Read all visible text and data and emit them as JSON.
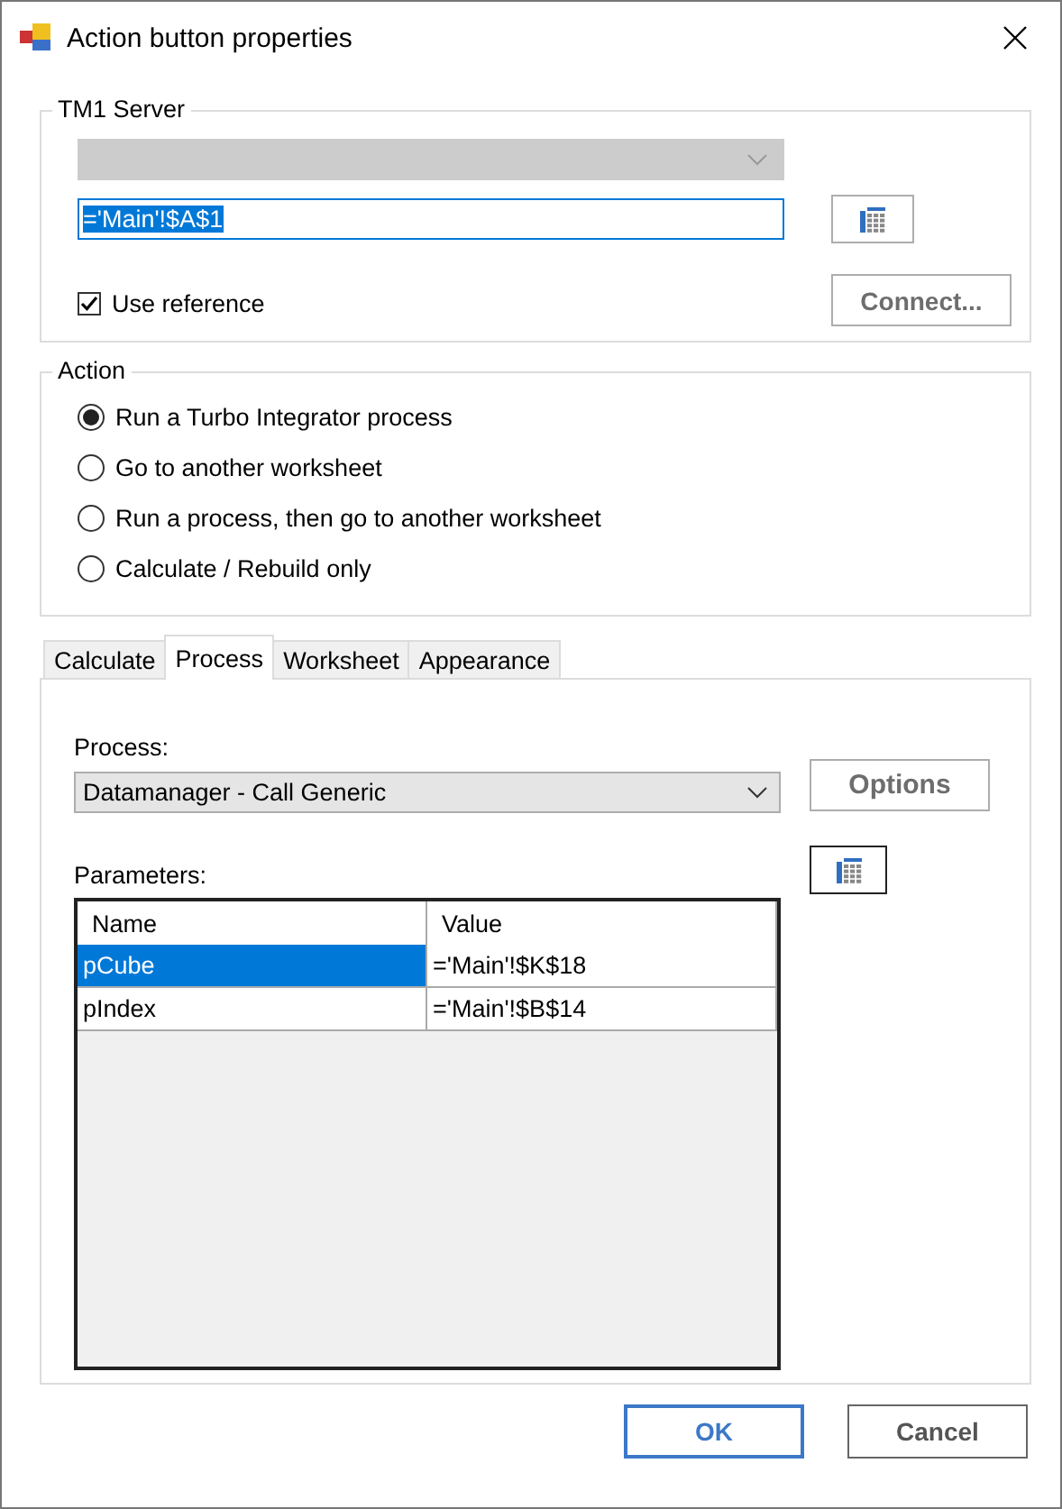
{
  "window": {
    "title": "Action button properties"
  },
  "tm1_server": {
    "title": "TM1 Server",
    "server_combo": {
      "disabled": true
    },
    "reference": {
      "value": "='Main'!$A$1",
      "text_selected": true
    },
    "use_reference": {
      "label": "Use reference",
      "checked": true
    },
    "connect_button": "Connect..."
  },
  "action": {
    "title": "Action",
    "options": [
      {
        "label": "Run a Turbo Integrator process",
        "selected": true
      },
      {
        "label": "Go to another worksheet",
        "selected": false
      },
      {
        "label": "Run a process, then go to another worksheet",
        "selected": false
      },
      {
        "label": "Calculate / Rebuild only",
        "selected": false
      }
    ]
  },
  "tabs": [
    {
      "label": "Calculate",
      "selected": false
    },
    {
      "label": "Process",
      "selected": true
    },
    {
      "label": "Worksheet",
      "selected": false
    },
    {
      "label": "Appearance",
      "selected": false
    }
  ],
  "process": {
    "label": "Process:",
    "value": "Datamanager - Call Generic",
    "options_button": "Options",
    "parameters_label": "Parameters:",
    "columns": [
      "Name",
      "Value"
    ],
    "rows": [
      {
        "name": "pCube",
        "value": "='Main'!$K$18",
        "selected": true
      },
      {
        "name": "pIndex",
        "value": "='Main'!$B$14",
        "selected": false
      }
    ]
  },
  "buttons": [
    {
      "label": "OK",
      "default": true
    },
    {
      "label": "Cancel",
      "default": false
    }
  ]
}
